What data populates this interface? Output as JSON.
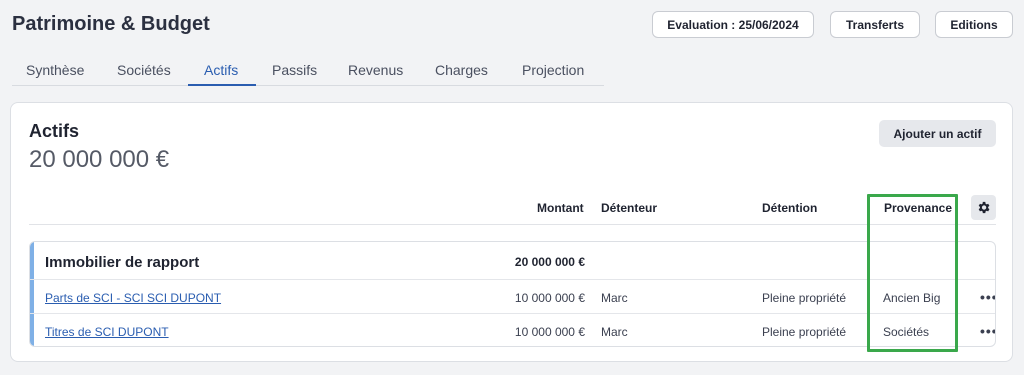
{
  "header": {
    "title": "Patrimoine & Budget",
    "evaluation_label": "Evaluation : 25/06/2024",
    "transfers_label": "Transferts",
    "editions_label": "Editions"
  },
  "tabs": [
    {
      "label": "Synthèse",
      "active": false
    },
    {
      "label": "Sociétés",
      "active": false
    },
    {
      "label": "Actifs",
      "active": true
    },
    {
      "label": "Passifs",
      "active": false
    },
    {
      "label": "Revenus",
      "active": false
    },
    {
      "label": "Charges",
      "active": false
    },
    {
      "label": "Projection",
      "active": false
    }
  ],
  "assets": {
    "title": "Actifs",
    "total": "20 000 000 €",
    "add_label": "Ajouter un actif",
    "columns": {
      "amount": "Montant",
      "holder": "Détenteur",
      "detention": "Détention",
      "provenance": "Provenance"
    },
    "settings_icon": "gear-icon",
    "group": {
      "title": "Immobilier de rapport",
      "amount": "20 000 000 €",
      "rows": [
        {
          "name": "Parts de SCI - SCI SCI DUPONT",
          "amount": "10 000 000 €",
          "holder": "Marc",
          "detention": "Pleine propriété",
          "provenance": "Ancien Big",
          "menu": "•••"
        },
        {
          "name": "Titres de SCI DUPONT",
          "amount": "10 000 000 €",
          "holder": "Marc",
          "detention": "Pleine propriété",
          "provenance": "Sociétés",
          "menu": "•••"
        }
      ]
    }
  },
  "colors": {
    "accent": "#2a5db0",
    "group_bar": "#7fb0e6",
    "highlight": "#3aa84b"
  }
}
